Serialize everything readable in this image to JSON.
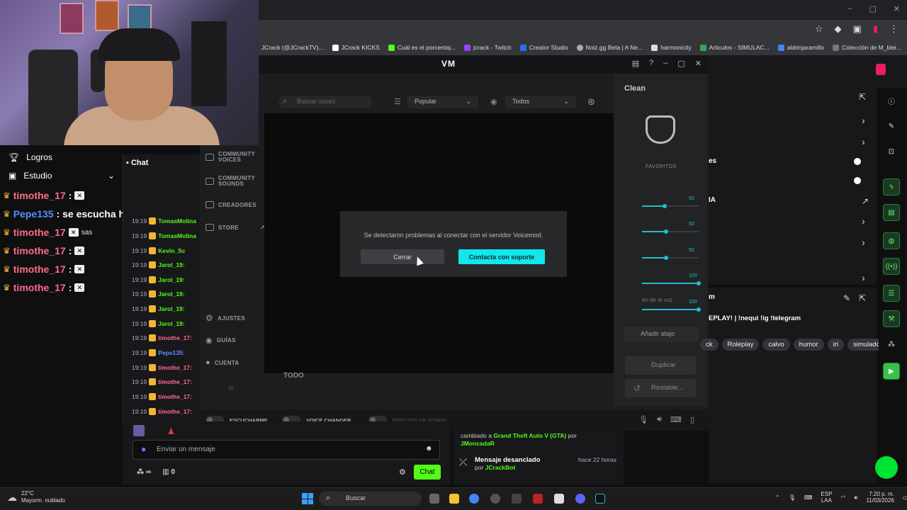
{
  "browser": {
    "bookmarks": [
      "JCrack (@JCrackTV)...",
      "JCrack KICKS",
      "Cuál es el porcentaj...",
      "jcrack - Twitch",
      "Creator Studio",
      "Noiz.gg Beta | A Ne...",
      "harmonicity",
      "Articulos - SIMULAC...",
      "aldrinjaramillo",
      "Colección de M_blei..."
    ]
  },
  "overlay": {
    "menu": [
      {
        "label": "Logros"
      },
      {
        "label": "Estudio"
      }
    ],
    "lines": [
      {
        "user": "timothe_17",
        "suffix": ":"
      },
      {
        "user": "Pepe135",
        "suffix": ": se escucha heavy hahaha"
      },
      {
        "user": "timothe_17",
        "suffix": "sas"
      },
      {
        "user": "timothe_17",
        "suffix": ":"
      },
      {
        "user": "timothe_17",
        "suffix": ":"
      },
      {
        "user": "timothe_17",
        "suffix": ":"
      }
    ]
  },
  "chat": {
    "header": "Chat",
    "rows": [
      {
        "time": "19:19",
        "user": "TomasMolina",
        "color": "#53fc18"
      },
      {
        "time": "19:19",
        "user": "TomasMolina",
        "color": "#53fc18"
      },
      {
        "time": "19:19",
        "user": "Kevin_Sc",
        "color": "#53fc18"
      },
      {
        "time": "19:19",
        "user": "Jarol_19:",
        "color": "#53fc18"
      },
      {
        "time": "19:19",
        "user": "Jarol_19:",
        "color": "#53fc18"
      },
      {
        "time": "19:19",
        "user": "Jarol_19:",
        "color": "#53fc18"
      },
      {
        "time": "19:19",
        "user": "Jarol_19:",
        "color": "#53fc18"
      },
      {
        "time": "19:19",
        "user": "Jarol_19:",
        "color": "#53fc18"
      },
      {
        "time": "19:19",
        "user": "timothe_17:",
        "color": "#ff6b8a"
      },
      {
        "time": "19:19",
        "user": "Pepe135:",
        "color": "#5a8dff"
      },
      {
        "time": "19:19",
        "user": "timothe_17:",
        "color": "#ff6b8a"
      },
      {
        "time": "19:19",
        "user": "timothe_17:",
        "color": "#ff6b8a"
      },
      {
        "time": "19:19",
        "user": "timothe_17:",
        "color": "#ff6b8a"
      },
      {
        "time": "19:19",
        "user": "timothe_17:",
        "color": "#ff6b8a"
      }
    ],
    "input_placeholder": "Enviar un mensaje",
    "send_label": "Chat",
    "count_viewers": "∞",
    "count_points": "0"
  },
  "voicemod": {
    "logo": "VM",
    "nav": [
      {
        "label": "COMMUNITY VOICES"
      },
      {
        "label": "COMMUNITY SOUNDS"
      },
      {
        "label": "CREADORES"
      },
      {
        "label": "STORE"
      },
      {
        "label": "AJUSTES"
      },
      {
        "label": "GUÍAS"
      },
      {
        "label": "CUENTA"
      }
    ],
    "search_placeholder": "Buscar voces",
    "sort_label": "Popular",
    "filter_label": "Todos",
    "section_label": "TODO",
    "right": {
      "title": "Clean",
      "favoritos": "FAVORITOS",
      "slider_values": [
        "50",
        "50",
        "50",
        "100",
        "100"
      ],
      "slider_frag": "en de la voz",
      "add_shortcut": "Añadir atajo",
      "duplicate": "Duplicar",
      "reset": "Restable..."
    },
    "bottom": {
      "listen": "ESCUCHARME",
      "voice_changer": "VOICE CHANGER",
      "effects": "EFECTOS DE FONDO"
    },
    "dialog": {
      "message": "Se detectaron problemas al conectar con el servidor Voicemod.",
      "close": "Cerrar",
      "support": "Contacta con soporte"
    }
  },
  "right_panel": {
    "frag1": "es",
    "frag2": "IA",
    "frag3": "m",
    "title_frag": "EPLAY! | !nequi !ig !telegram",
    "tags": [
      "ck",
      "Roleplay",
      "calvo",
      "humor",
      "irl",
      "simulado"
    ]
  },
  "events": [
    {
      "line1": "cambiado a",
      "game": "Grand Theft Auto V (GTA)",
      "by": "por",
      "user": "JMoncadaR"
    },
    {
      "title": "Mensaje desanclado",
      "time": "hace 22 horas",
      "by": "por",
      "user": "JCrackBot"
    }
  ],
  "taskbar": {
    "temp": "22°C",
    "weather": "Mayorm. nublado",
    "search": "Buscar",
    "lang1": "ESP",
    "lang2": "LAA",
    "time": "7:20 p. m.",
    "date": "11/03/2026"
  }
}
